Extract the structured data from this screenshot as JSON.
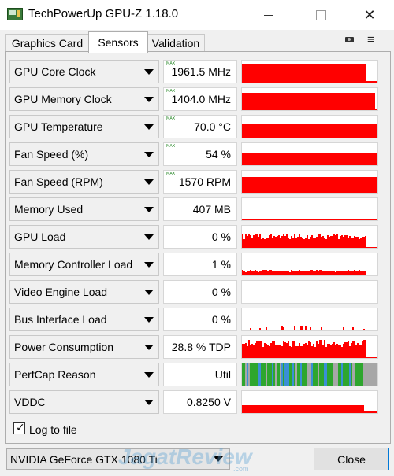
{
  "window": {
    "title": "TechPowerUp GPU-Z 1.18.0",
    "app_icon": "gpu-card-icon",
    "controls": {
      "minimize_icon": "minimize-icon",
      "maximize_icon": "maximize-icon",
      "close_glyph": "✕"
    }
  },
  "tabs": [
    {
      "label": "Graphics Card",
      "active": false
    },
    {
      "label": "Sensors",
      "active": true
    },
    {
      "label": "Validation",
      "active": false
    }
  ],
  "toolbar": {
    "screenshot_icon": "camera-icon",
    "menu_glyph": "≡"
  },
  "sensors": [
    {
      "name": "GPU Core Clock",
      "value": "1961.5 MHz",
      "max_tag": "MAX",
      "graph_type": "level",
      "level": 0.84,
      "end": 0.92
    },
    {
      "name": "GPU Memory Clock",
      "value": "1404.0 MHz",
      "max_tag": "MAX",
      "graph_type": "level",
      "level": 0.8,
      "end": 0.98
    },
    {
      "name": "GPU Temperature",
      "value": "70.0 °C",
      "max_tag": "MAX",
      "graph_type": "level",
      "level": 0.62,
      "end": 1.0
    },
    {
      "name": "Fan Speed (%)",
      "value": "54 %",
      "max_tag": "MAX",
      "graph_type": "level",
      "level": 0.55,
      "end": 1.0
    },
    {
      "name": "Fan Speed (RPM)",
      "value": "1570 RPM",
      "max_tag": "MAX",
      "graph_type": "level",
      "level": 0.72,
      "end": 1.0
    },
    {
      "name": "Memory Used",
      "value": "407 MB",
      "max_tag": "",
      "graph_type": "level",
      "level": 0.07,
      "end": 1.0
    },
    {
      "name": "GPU Load",
      "value": "0 %",
      "max_tag": "",
      "graph_type": "noisy",
      "level": 0.55,
      "end": 0.92
    },
    {
      "name": "Memory Controller Load",
      "value": "1 %",
      "max_tag": "",
      "graph_type": "low",
      "level": 0.22,
      "end": 0.92
    },
    {
      "name": "Video Engine Load",
      "value": "0 %",
      "max_tag": "",
      "graph_type": "empty",
      "level": 0.0,
      "end": 1.0
    },
    {
      "name": "Bus Interface Load",
      "value": "0 %",
      "max_tag": "",
      "graph_type": "sparse",
      "level": 0.08,
      "end": 0.92
    },
    {
      "name": "Power Consumption",
      "value": "28.8 % TDP",
      "max_tag": "",
      "graph_type": "noisy",
      "level": 0.72,
      "end": 0.92
    },
    {
      "name": "PerfCap Reason",
      "value": "Util",
      "max_tag": "",
      "graph_type": "perfcap",
      "level": 1.0,
      "end": 0.9
    },
    {
      "name": "VDDC",
      "value": "0.8250 V",
      "max_tag": "",
      "graph_type": "level",
      "level": 0.35,
      "end": 0.9
    }
  ],
  "log_to_file": {
    "label": "Log to file",
    "checked": true,
    "check_glyph": "✓"
  },
  "gpu_select": {
    "value": "NVIDIA GeForce GTX 1080 Ti"
  },
  "watermark": {
    "text": "JagatReview",
    "sub": ".com"
  },
  "close_button": {
    "label": "Close"
  },
  "colors": {
    "graph": "#ff0000",
    "perfcap_green": "#2ea62e",
    "perfcap_blue": "#3a8fd6",
    "perfcap_gray": "#a7a7a7"
  }
}
